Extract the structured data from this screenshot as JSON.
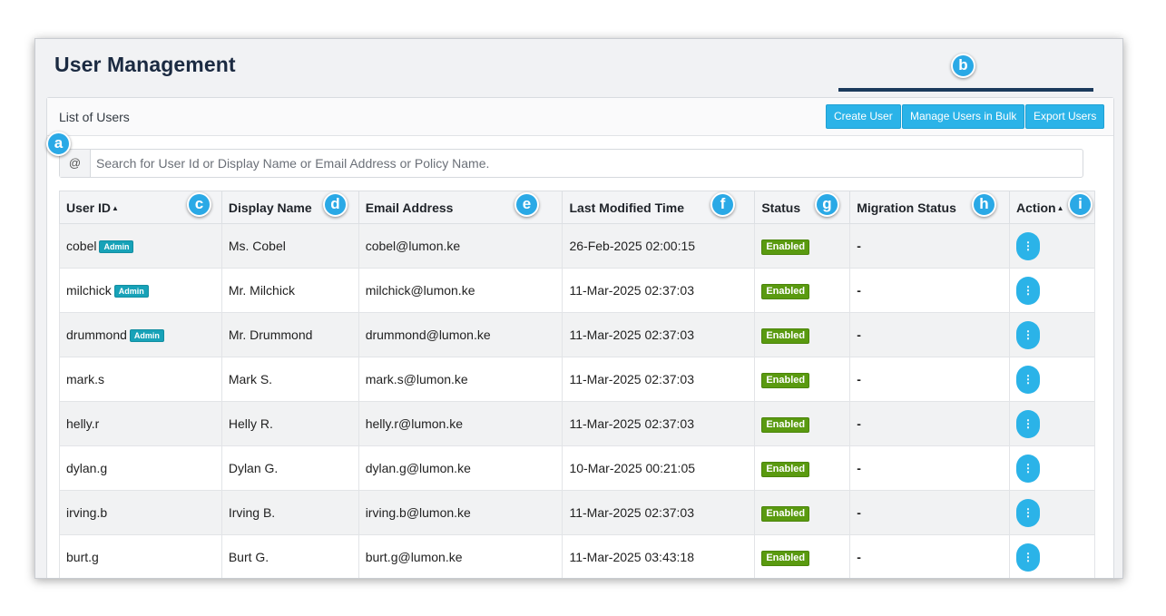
{
  "header": {
    "title": "User Management"
  },
  "panel": {
    "title": "List of Users",
    "buttons": {
      "create": "Create User",
      "bulk": "Manage Users in Bulk",
      "export": "Export Users"
    }
  },
  "search": {
    "prefix": "@",
    "placeholder": "Search for User Id or Display Name or Email Address or Policy Name."
  },
  "table": {
    "columns": [
      "User ID",
      "Display Name",
      "Email Address",
      "Last Modified Time",
      "Status",
      "Migration Status",
      "Action"
    ],
    "rows": [
      {
        "user_id": "cobel",
        "admin": "Admin",
        "display_name": "Ms. Cobel",
        "email": "cobel@lumon.ke",
        "modified": "26-Feb-2025 02:00:15",
        "status": "Enabled",
        "migration": "-"
      },
      {
        "user_id": "milchick",
        "admin": "Admin",
        "display_name": "Mr. Milchick",
        "email": "milchick@lumon.ke",
        "modified": "11-Mar-2025 02:37:03",
        "status": "Enabled",
        "migration": "-"
      },
      {
        "user_id": "drummond",
        "admin": "Admin",
        "display_name": "Mr. Drummond",
        "email": "drummond@lumon.ke",
        "modified": "11-Mar-2025 02:37:03",
        "status": "Enabled",
        "migration": "-"
      },
      {
        "user_id": "mark.s",
        "admin": "",
        "display_name": "Mark S.",
        "email": "mark.s@lumon.ke",
        "modified": "11-Mar-2025 02:37:03",
        "status": "Enabled",
        "migration": "-"
      },
      {
        "user_id": "helly.r",
        "admin": "",
        "display_name": "Helly R.",
        "email": "helly.r@lumon.ke",
        "modified": "11-Mar-2025 02:37:03",
        "status": "Enabled",
        "migration": "-"
      },
      {
        "user_id": "dylan.g",
        "admin": "",
        "display_name": "Dylan G.",
        "email": "dylan.g@lumon.ke",
        "modified": "10-Mar-2025 00:21:05",
        "status": "Enabled",
        "migration": "-"
      },
      {
        "user_id": "irving.b",
        "admin": "",
        "display_name": "Irving B.",
        "email": "irving.b@lumon.ke",
        "modified": "11-Mar-2025 02:37:03",
        "status": "Enabled",
        "migration": "-"
      },
      {
        "user_id": "burt.g",
        "admin": "",
        "display_name": "Burt G.",
        "email": "burt.g@lumon.ke",
        "modified": "11-Mar-2025 03:43:18",
        "status": "Enabled",
        "migration": "-"
      }
    ],
    "action_icon": "vertical-ellipsis-icon",
    "sort_icon": "sort-up-triangle-icon"
  },
  "callouts": [
    "a",
    "b",
    "c",
    "d",
    "e",
    "f",
    "g",
    "h",
    "i"
  ],
  "colors": {
    "accent": "#2bb3e8",
    "status_enabled": "#5a9a10",
    "admin_badge": "#17a2b8",
    "title": "#1b2a41",
    "callout": "#2aa9e6"
  }
}
